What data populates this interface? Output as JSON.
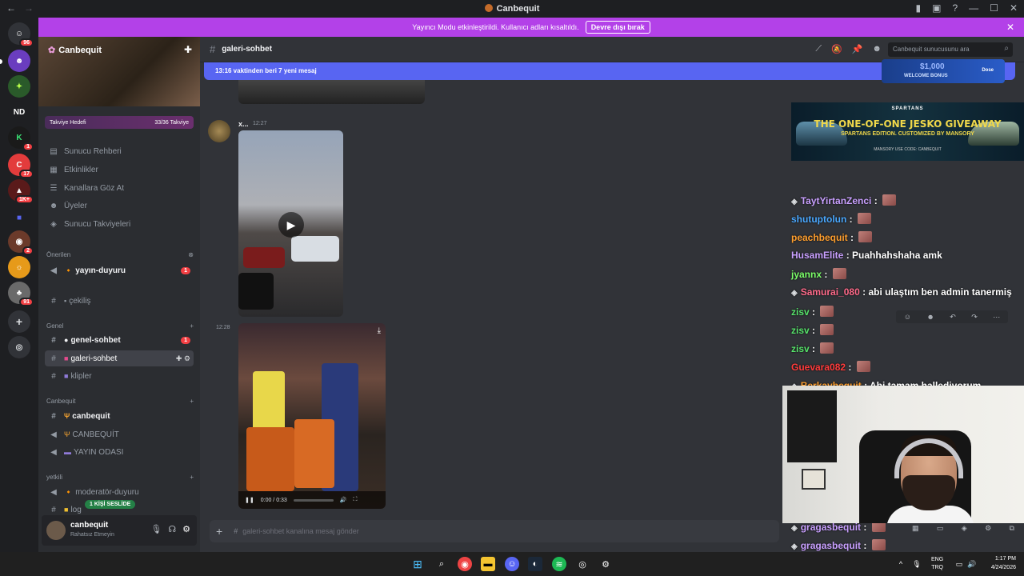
{
  "window": {
    "title": "Canbequit"
  },
  "banner": {
    "text": "Yayıncı Modu etkinleştirildi. Kullanıcı adları kısaltıldı.",
    "button": "Devre dışı bırak"
  },
  "rail": {
    "badges": [
      "96",
      "1",
      "17",
      "1K+",
      "2",
      "91"
    ],
    "nd_label": "ND"
  },
  "server": {
    "name": "Canbequit",
    "boost_label": "Takviye Hedefi",
    "boost_progress": "33/36 Takviye",
    "boost_fraction": 0.917
  },
  "sidebar": {
    "menu": [
      {
        "label": "Sunucu Rehberi",
        "icon": "compass-icon"
      },
      {
        "label": "Etkinlikler",
        "icon": "calendar-icon"
      },
      {
        "label": "Kanallara Göz At",
        "icon": "browse-icon"
      },
      {
        "label": "Üyeler",
        "icon": "members-icon"
      },
      {
        "label": "Sunucu Takviyeleri",
        "icon": "boost-icon"
      }
    ],
    "cat_suggested": "Önerilen",
    "suggested_channel": "yayın-duyuru",
    "suggested_badge": "1",
    "cekilis": "çekiliş",
    "cat_genel": "Genel",
    "genel_sohbet": "genel-sohbet",
    "genel_badge": "1",
    "galeri_sohbet": "galeri-sohbet",
    "klipler": "klipler",
    "cat_canbequit": "Canbequit",
    "canbequit_ch": "canbequit",
    "canbequit_voice": "CANBEQUİT",
    "yayin_odasi": "YAYIN ODASI",
    "cat_yetkili": "yetkili",
    "moderator": "moderatör-duyuru",
    "log": "log",
    "voice_pill": "1 KİŞİ SESLİDE"
  },
  "user": {
    "name": "canbequit",
    "status": "Rahatsız Etmeyin"
  },
  "channel": {
    "name": "galeri-sohbet",
    "search_placeholder": "Canbequit sunucusunu ara",
    "new_messages": "13:16 vaktinden beri 7 yeni mesaj",
    "composer_placeholder": "galeri-sohbet kanalına mesaj gönder"
  },
  "messages": [
    {
      "user": "x...",
      "time": "12:27"
    },
    {
      "time": "12:28",
      "video_time": "0:00 / 0:33"
    }
  ],
  "stream_ads": {
    "top_big": "$1,000",
    "top_small": "WELCOME BONUS",
    "top_brand": "Dose",
    "main_brand": "SPARTANS",
    "main_head": "THE ONE-OF-ONE JESKO GIVEAWAY",
    "main_sub": "SPARTANS EDITION. CUSTOMIZED BY MANSORY",
    "main_footer": "MANSORY   USE CODE: CANBEQUIT"
  },
  "stream_chat": [
    {
      "user": "TaytYirtanZenci",
      "color": "#c9a0ff",
      "msg": "",
      "emote": true,
      "badge": true
    },
    {
      "user": "shutuptolun",
      "color": "#4aa8ff",
      "msg": "",
      "emote": true,
      "badge": false
    },
    {
      "user": "peachbequit",
      "color": "#ff9f2e",
      "msg": "",
      "emote": true,
      "badge": false
    },
    {
      "user": "HusamElite",
      "color": "#c9a0ff",
      "msg": "Puahhahshaha amk",
      "emote": false,
      "badge": false
    },
    {
      "user": "jyannx",
      "color": "#7cff6a",
      "msg": "",
      "emote": true,
      "badge": false
    },
    {
      "user": "Samurai_080",
      "color": "#ff6a8a",
      "msg": "abi ulaştım ben admin tanermiş",
      "emote": false,
      "badge": true
    },
    {
      "user": "zisv",
      "color": "#57e36b",
      "msg": "",
      "emote": true,
      "badge": false
    },
    {
      "user": "zisv",
      "color": "#57e36b",
      "msg": "",
      "emote": true,
      "badge": false
    },
    {
      "user": "zisv",
      "color": "#57e36b",
      "msg": "",
      "emote": true,
      "badge": false
    },
    {
      "user": "Guevara082",
      "color": "#ff3b3b",
      "msg": "",
      "emote": true,
      "badge": false
    },
    {
      "user": "Berkaybequit",
      "color": "#ff9f2e",
      "msg": "Abi tamam hallediyorum",
      "emote": false,
      "badge": true
    },
    {
      "user": "gragasbequit",
      "color": "#c9a0ff",
      "msg": "",
      "emote": true,
      "badge": true
    },
    {
      "user": "gragasbequit",
      "color": "#c9a0ff",
      "msg": "",
      "emote": true,
      "badge": true
    },
    {
      "user": "gragasbequit",
      "color": "#c9a0ff",
      "msg": "",
      "emote": true,
      "badge": true
    }
  ],
  "taskbar": {
    "lang_top": "ENG",
    "lang_bottom": "TRQ",
    "time": "1:17 PM",
    "date": "4/24/2026"
  },
  "colors": {
    "banner": "#b341e8",
    "new_messages": "#5865f2",
    "sidebar": "#2b2d31",
    "chat": "#313338"
  }
}
